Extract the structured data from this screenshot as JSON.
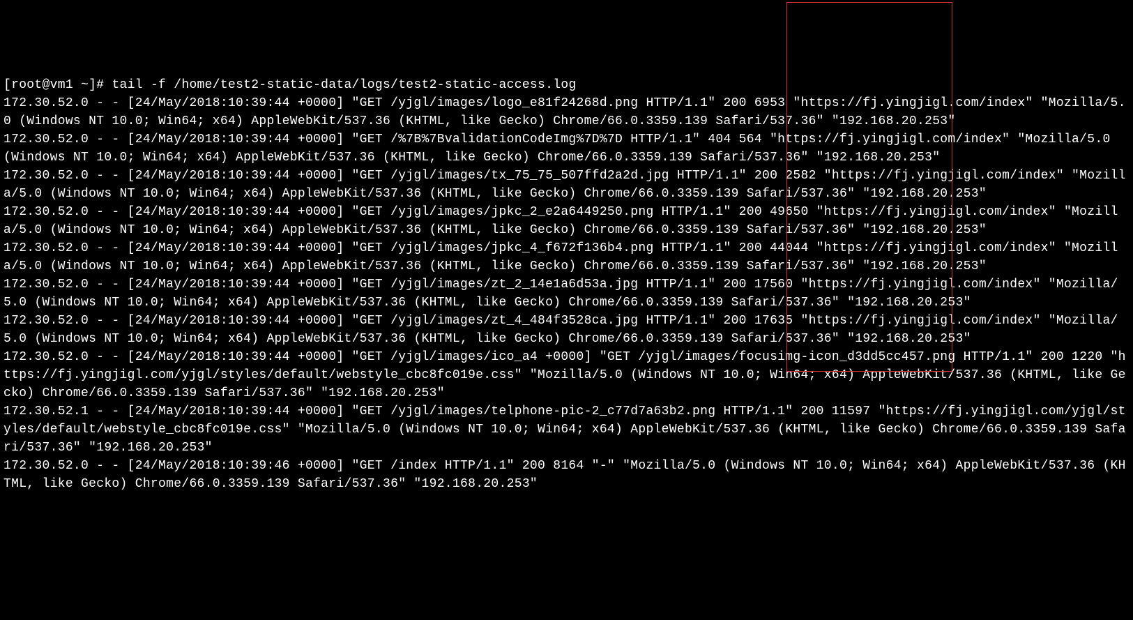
{
  "terminal": {
    "prompt": "[root@vm1 ~]# ",
    "command": "tail -f /home/test2-static-data/logs/test2-static-access.log",
    "logLines": [
      "172.30.52.0 - - [24/May/2018:10:39:44 +0000] \"GET /yjgl/images/logo_e81f24268d.png HTTP/1.1\" 200 6953 \"https://fj.yingjigl.com/index\" \"Mozilla/5.0 (Windows NT 10.0; Win64; x64) AppleWebKit/537.36 (KHTML, like Gecko) Chrome/66.0.3359.139 Safari/537.36\" \"192.168.20.253\"",
      "172.30.52.0 - - [24/May/2018:10:39:44 +0000] \"GET /%7B%7BvalidationCodeImg%7D%7D HTTP/1.1\" 404 564 \"https://fj.yingjigl.com/index\" \"Mozilla/5.0 (Windows NT 10.0; Win64; x64) AppleWebKit/537.36 (KHTML, like Gecko) Chrome/66.0.3359.139 Safari/537.36\" \"192.168.20.253\"",
      "172.30.52.0 - - [24/May/2018:10:39:44 +0000] \"GET /yjgl/images/tx_75_75_507ffd2a2d.jpg HTTP/1.1\" 200 2582 \"https://fj.yingjigl.com/index\" \"Mozilla/5.0 (Windows NT 10.0; Win64; x64) AppleWebKit/537.36 (KHTML, like Gecko) Chrome/66.0.3359.139 Safari/537.36\" \"192.168.20.253\"",
      "172.30.52.0 - - [24/May/2018:10:39:44 +0000] \"GET /yjgl/images/jpkc_2_e2a6449250.png HTTP/1.1\" 200 49650 \"https://fj.yingjigl.com/index\" \"Mozilla/5.0 (Windows NT 10.0; Win64; x64) AppleWebKit/537.36 (KHTML, like Gecko) Chrome/66.0.3359.139 Safari/537.36\" \"192.168.20.253\"",
      "172.30.52.0 - - [24/May/2018:10:39:44 +0000] \"GET /yjgl/images/jpkc_4_f672f136b4.png HTTP/1.1\" 200 44044 \"https://fj.yingjigl.com/index\" \"Mozilla/5.0 (Windows NT 10.0; Win64; x64) AppleWebKit/537.36 (KHTML, like Gecko) Chrome/66.0.3359.139 Safari/537.36\" \"192.168.20.253\"",
      "172.30.52.0 - - [24/May/2018:10:39:44 +0000] \"GET /yjgl/images/zt_2_14e1a6d53a.jpg HTTP/1.1\" 200 17560 \"https://fj.yingjigl.com/index\" \"Mozilla/5.0 (Windows NT 10.0; Win64; x64) AppleWebKit/537.36 (KHTML, like Gecko) Chrome/66.0.3359.139 Safari/537.36\" \"192.168.20.253\"",
      "172.30.52.0 - - [24/May/2018:10:39:44 +0000] \"GET /yjgl/images/zt_4_484f3528ca.jpg HTTP/1.1\" 200 17635 \"https://fj.yingjigl.com/index\" \"Mozilla/5.0 (Windows NT 10.0; Win64; x64) AppleWebKit/537.36 (KHTML, like Gecko) Chrome/66.0.3359.139 Safari/537.36\" \"192.168.20.253\"",
      "172.30.52.0 - - [24/May/2018:10:39:44 +0000] \"GET /yjgl/images/ico_a4 +0000] \"GET /yjgl/images/focusimg-icon_d3dd5cc457.png HTTP/1.1\" 200 1220 \"https://fj.yingjigl.com/yjgl/styles/default/webstyle_cbc8fc019e.css\" \"Mozilla/5.0 (Windows NT 10.0; Win64; x64) AppleWebKit/537.36 (KHTML, like Gecko) Chrome/66.0.3359.139 Safari/537.36\" \"192.168.20.253\"",
      "172.30.52.1 - - [24/May/2018:10:39:44 +0000] \"GET /yjgl/images/telphone-pic-2_c77d7a63b2.png HTTP/1.1\" 200 11597 \"https://fj.yingjigl.com/yjgl/styles/default/webstyle_cbc8fc019e.css\" \"Mozilla/5.0 (Windows NT 10.0; Win64; x64) AppleWebKit/537.36 (KHTML, like Gecko) Chrome/66.0.3359.139 Safari/537.36\" \"192.168.20.253\"",
      "172.30.52.0 - - [24/May/2018:10:39:46 +0000] \"GET /index HTTP/1.1\" 200 8164 \"-\" \"Mozilla/5.0 (Windows NT 10.0; Win64; x64) AppleWebKit/537.36 (KHTML, like Gecko) Chrome/66.0.3359.139 Safari/537.36\" \"192.168.20.253\""
    ]
  }
}
